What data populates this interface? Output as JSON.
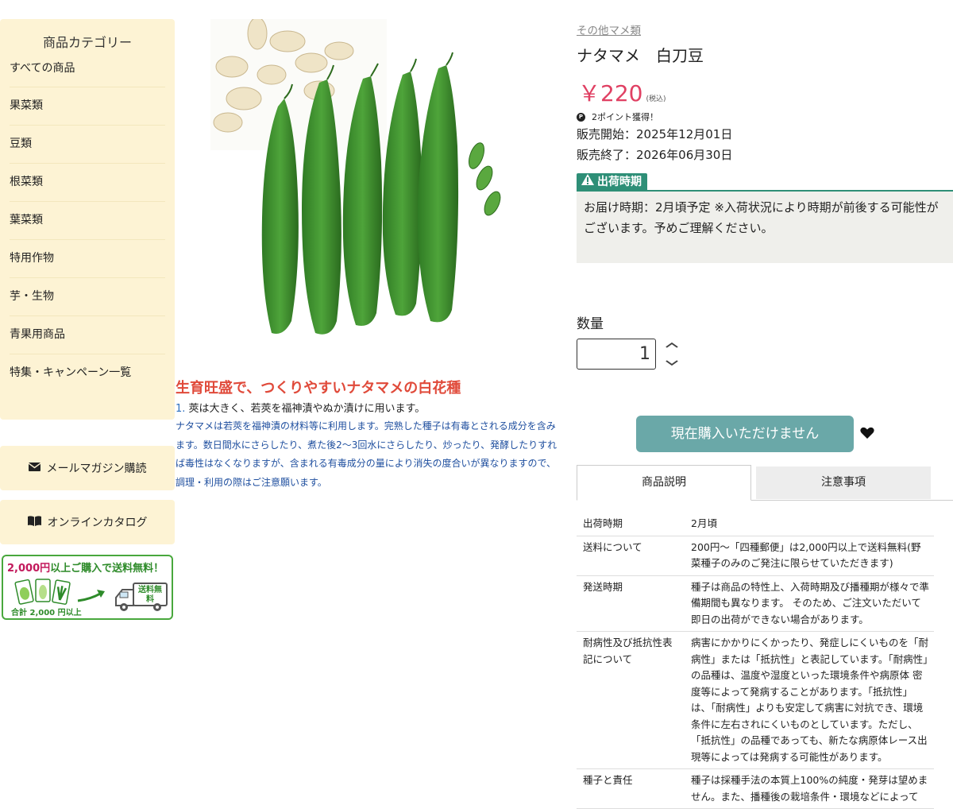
{
  "sidebar": {
    "title": "商品カテゴリー",
    "categories": [
      "すべての商品",
      "果菜類",
      "豆類",
      "根菜類",
      "葉菜類",
      "特用作物",
      "芋・生物",
      "青果用商品",
      "特集・キャンペーン一覧"
    ],
    "mail_magazine": "メールマガジン購読",
    "online_catalog": "オンラインカタログ",
    "banner": {
      "amount": "2,000",
      "unit": "円",
      "text": "以上ご購入で送料無料！",
      "sub": "合計 2,000 円以上",
      "truck_text": "送料無料"
    }
  },
  "product": {
    "category_link": "その他マメ類",
    "name": "ナタマメ　白刀豆",
    "price": "￥220",
    "tax": "(税込)",
    "points": "2ポイント獲得！",
    "sale_start": "販売開始：2025年12月01日",
    "sale_end": "販売終了：2026年06月30日",
    "shipping_label": "出荷時期",
    "shipping_text": "お届け時期：2月頃予定 ※入荷状況により時期が前後する可能性がございます。予めご理解ください。",
    "quantity_label": "数量",
    "quantity": "1",
    "buy_button": "現在購入いただけません",
    "catch_copy": "生育旺盛で、つくりやすいナタマメの白花種",
    "feature_num": "1.",
    "feature_text": "莢は大きく、若莢を福神漬やぬか漬けに用います。",
    "note": "ナタマメは若莢を福神漬の材料等に利用します。完熟した種子は有毒とされる成分を含みます。数日間水にさらしたり、煮た後2〜3回水にさらしたり、炒ったり、発酵したりすれば毒性はなくなりますが、含まれる有毒成分の量により消失の度合いが異なりますので、調理・利用の際はご注意願います。"
  },
  "tabs": [
    "商品説明",
    "注意事項"
  ],
  "specs": [
    {
      "k": "出荷時期",
      "v": "2月頃"
    },
    {
      "k": "送料について",
      "v": "200円〜「四種郵便」は2,000円以上で送料無料(野菜種子のみのご発注に限らせていただきます)"
    },
    {
      "k": "発送時期",
      "v": "種子は商品の特性上、入荷時期及び播種期が様々で準備期間も異なります。 そのため、ご注文いただいて即日の出荷ができない場合があります。"
    },
    {
      "k": "耐病性及び抵抗性表記について",
      "v": "病害にかかりにくかったり、発症しにくいものを「耐病性」または「抵抗性」と表記しています。「耐病性」の品種は、温度や湿度といった環境条件や病原体 密度等によって発病することがあります。「抵抗性」は、「耐病性」よりも安定して病害に対抗でき、環境条件に左右されにくいものとしています。ただし、「抵抗性」の品種であっても、新たな病原体レース出現等によっては発病する可能性があります。"
    },
    {
      "k": "種子と責任",
      "v": "種子は採種手法の本質上100%の純度・発芽は望めません。また、播種後の栽培条件・環境などによって"
    }
  ],
  "colors": {
    "sidebar_bg": "#fdf3d4",
    "price": "#e04063",
    "catch_copy": "#e04a3a",
    "note": "#1f4f9f",
    "shipping_accent": "#2e8f77",
    "buy_button": "#6aa8a8"
  }
}
